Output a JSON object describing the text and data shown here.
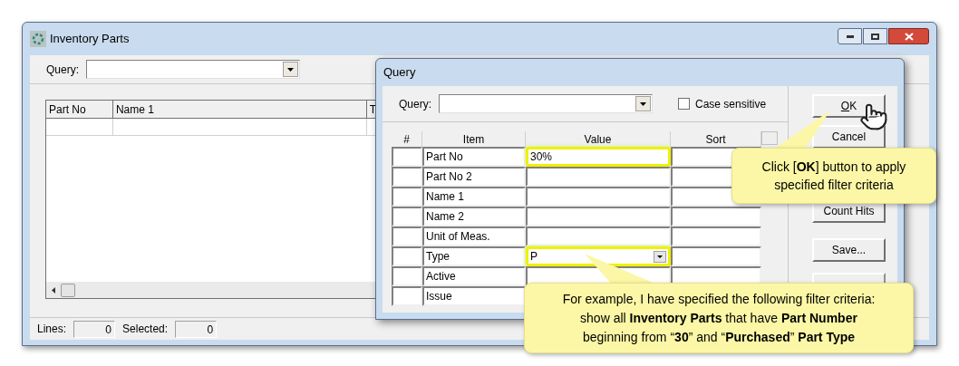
{
  "main_window": {
    "title": "Inventory Parts",
    "query_label": "Query:",
    "table": {
      "columns": [
        "Part No",
        "Name 1",
        "T"
      ]
    },
    "status_bar": [
      {
        "label": "Lines:",
        "value": "0"
      },
      {
        "label": "Selected:",
        "value": "0"
      }
    ]
  },
  "query_dialog": {
    "title": "Query",
    "query_label": "Query:",
    "case_sensitive": {
      "label": "Case sensitive",
      "checked": false
    },
    "columns": [
      "#",
      "Item",
      "Value",
      "Sort"
    ],
    "rows": [
      {
        "item": "Part No",
        "value": "30%",
        "kind": "text",
        "highlighted": true
      },
      {
        "item": "Part No 2",
        "kind": "text",
        "highlighted": false
      },
      {
        "item": "Name 1",
        "kind": "text",
        "highlighted": false
      },
      {
        "item": "Name 2",
        "kind": "text",
        "highlighted": false
      },
      {
        "item": "Unit of Meas.",
        "kind": "text",
        "highlighted": false
      },
      {
        "item": "Type",
        "value": "P",
        "kind": "dropdown",
        "highlighted": true
      },
      {
        "item": "Active",
        "kind": "text",
        "highlighted": false
      },
      {
        "item": "Issue"
      }
    ],
    "buttons": [
      {
        "label": "OK",
        "underline_first": true,
        "disabled": false
      },
      {
        "label": "Cancel",
        "underline_first": false,
        "disabled": false
      },
      {
        "label": "Count Hits",
        "underline_first": false,
        "disabled": false
      },
      {
        "label": "Save...",
        "underline_first": false,
        "disabled": false
      }
    ]
  },
  "callouts": [
    {
      "text": "Click [**OK**] button to apply specified filter criteria"
    },
    {
      "text": "For example, I have specified the following filter criteria: show all **Inventory Parts** that have **Part Number** beginning from “**30**” and “**Purchased**”  **Part Type**"
    }
  ]
}
